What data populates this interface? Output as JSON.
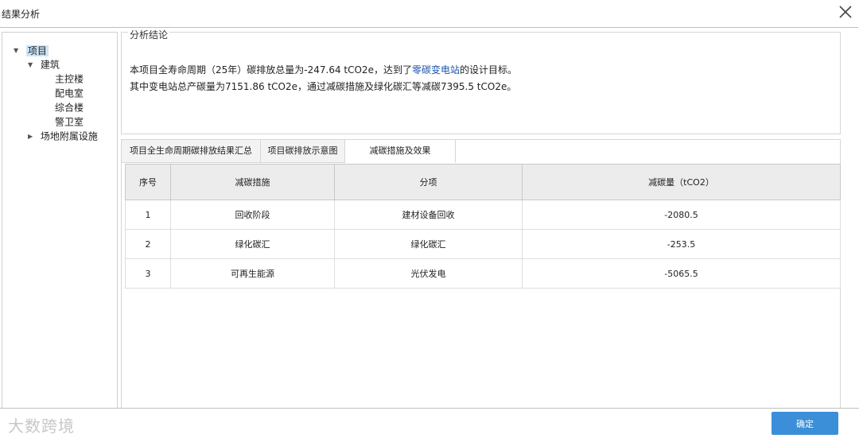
{
  "window": {
    "title": "结果分析"
  },
  "tree": {
    "root": {
      "label": "项目",
      "expanded": true,
      "selected": true
    },
    "building": {
      "label": "建筑",
      "expanded": true
    },
    "children": [
      "主控楼",
      "配电室",
      "综合楼",
      "警卫室"
    ],
    "site": {
      "label": "场地附属设施",
      "expanded": false
    }
  },
  "conclusion": {
    "legend": "分析结论",
    "line1_prefix": "本项目全寿命周期（25年）碳排放总量为-247.64 tCO2e，达到了",
    "line1_link": "零碳变电站",
    "line1_suffix": "的设计目标。",
    "line2": "其中变电站总产碳量为7151.86 tCO2e，通过减碳措施及绿化碳汇等减碳7395.5 tCO2e。"
  },
  "tabs": [
    {
      "label": "项目全生命周期碳排放结果汇总",
      "active": false
    },
    {
      "label": "项目碳排放示意图",
      "active": false
    },
    {
      "label": "减碳措施及效果",
      "active": true
    }
  ],
  "table": {
    "headers": [
      "序号",
      "减碳措施",
      "分项",
      "减碳量（tCO2）"
    ],
    "rows": [
      [
        "1",
        "回收阶段",
        "建材设备回收",
        "-2080.5"
      ],
      [
        "2",
        "绿化碳汇",
        "绿化碳汇",
        "-253.5"
      ],
      [
        "3",
        "可再生能源",
        "光伏发电",
        "-5065.5"
      ]
    ]
  },
  "footer": {
    "watermark": "大数跨境",
    "ok_label": "确定"
  },
  "colors": {
    "accent": "#3a8fd8",
    "link": "#1a53b0",
    "selection": "#cce4f7"
  }
}
